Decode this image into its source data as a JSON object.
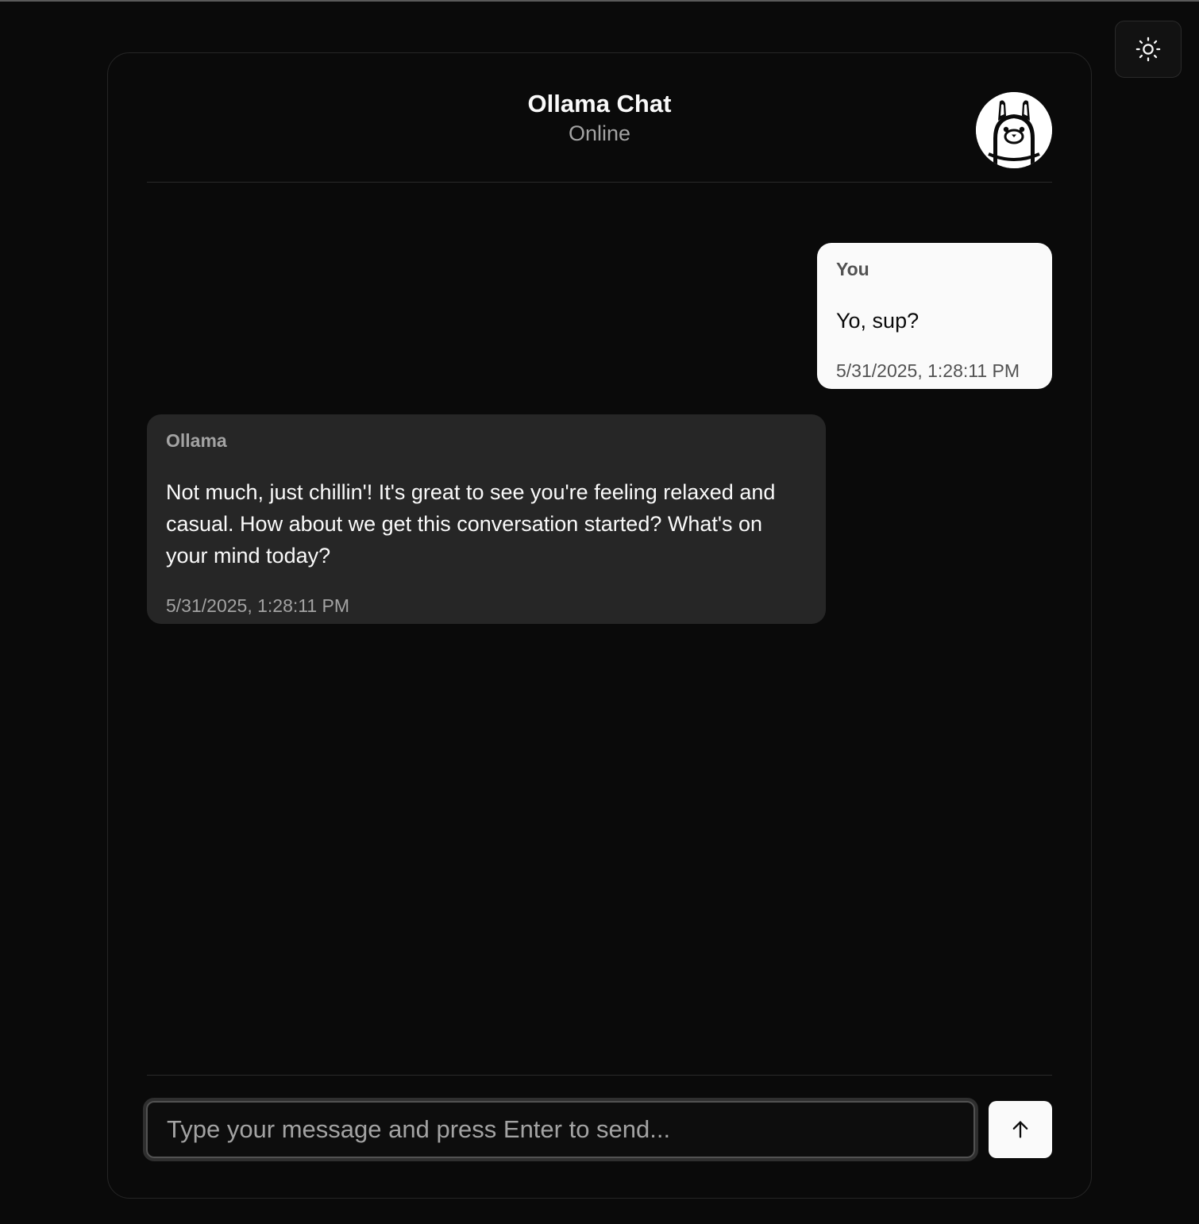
{
  "app": {
    "title": "Ollama Chat",
    "status": "Online"
  },
  "theme_toggle": {
    "icon": "sun-icon"
  },
  "avatar": {
    "icon": "ollama-llama-icon"
  },
  "messages": [
    {
      "sender": "You",
      "text": "Yo, sup?",
      "timestamp": "5/31/2025, 1:28:11 PM"
    },
    {
      "sender": "Ollama",
      "text": "Not much, just chillin'! It's great to see you're feeling relaxed and casual. How about we get this conversation started? What's on your mind today?",
      "timestamp": "5/31/2025, 1:28:11 PM"
    }
  ],
  "composer": {
    "placeholder": "Type your message and press Enter to send...",
    "value": "",
    "send_icon": "arrow-up-icon"
  },
  "colors": {
    "background": "#0a0a0a",
    "user_bubble": "#fafafa",
    "bot_bubble": "#262626",
    "muted_text": "#a3a3a3"
  }
}
